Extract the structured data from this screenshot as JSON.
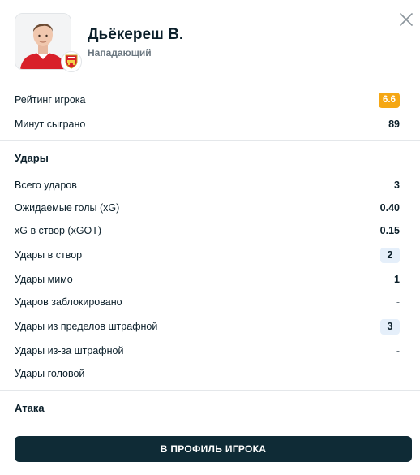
{
  "player": {
    "name": "Дьёкереш В.",
    "position": "Нападающий",
    "photo_icon": "player-photo",
    "club_icon": "arsenal-crest-icon"
  },
  "summary": {
    "rating_label": "Рейтинг игрока",
    "rating_value": "6.6",
    "minutes_label": "Минут сыграно",
    "minutes_value": "89"
  },
  "shots": {
    "title": "Удары",
    "rows": [
      {
        "label": "Всего ударов",
        "value": "3"
      },
      {
        "label": "Ожидаемые голы (xG)",
        "value": "0.40"
      },
      {
        "label": "xG в створ (xGOT)",
        "value": "0.15"
      },
      {
        "label": "Удары в створ",
        "value": "2"
      },
      {
        "label": "Удары мимо",
        "value": "1"
      },
      {
        "label": "Ударов заблокировано",
        "value": "-"
      },
      {
        "label": "Удары из пределов штрафной",
        "value": "3"
      },
      {
        "label": "Удары из-за штрафной",
        "value": "-"
      },
      {
        "label": "Удары головой",
        "value": "-"
      }
    ]
  },
  "attack": {
    "title": "Атака"
  },
  "cta": {
    "label": "В ПРОФИЛЬ ИГРОКА"
  },
  "colors": {
    "rating_badge": "#f5a714",
    "highlight_pill": "#e5effa",
    "cta_background": "#0f2b36"
  }
}
